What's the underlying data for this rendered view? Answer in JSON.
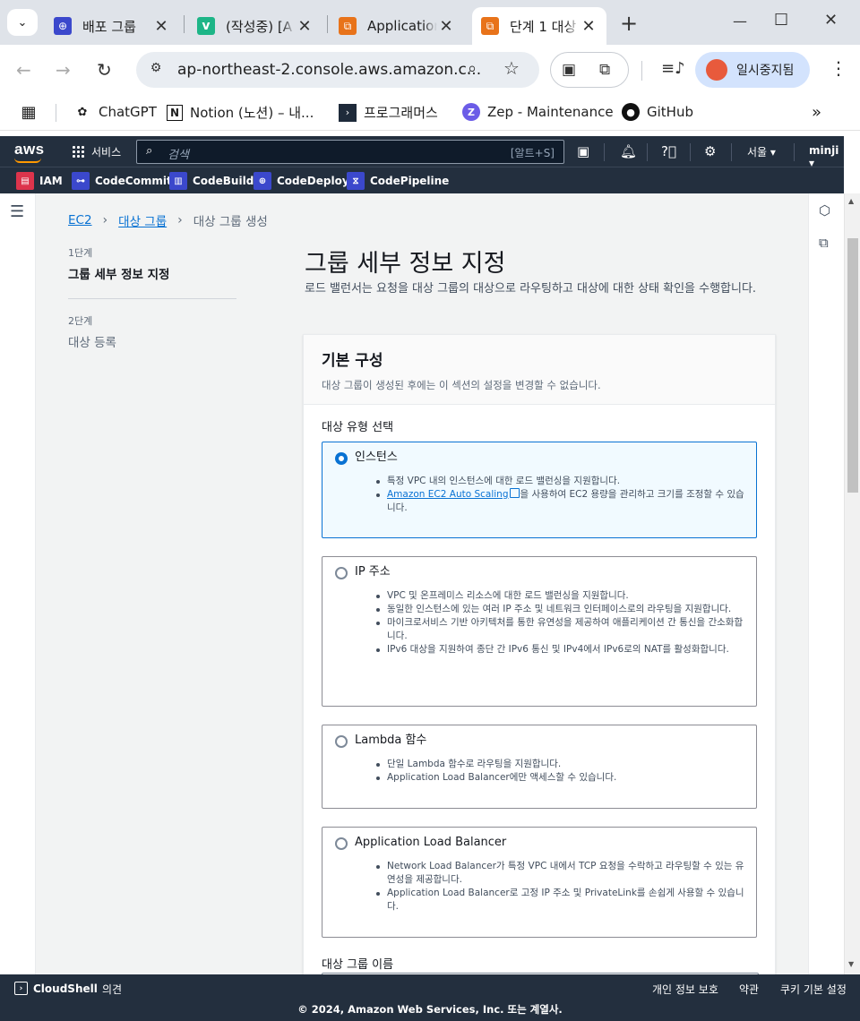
{
  "browser": {
    "tabs": [
      {
        "title": "배포 그룹",
        "favicon_color": "#3b48cc",
        "favicon_glyph": "⊕"
      },
      {
        "title": "(작성중) [A",
        "favicon_color": "#1db587",
        "favicon_glyph": "v"
      },
      {
        "title": "Application",
        "favicon_color": "#e8731a",
        "favicon_glyph": "⧉"
      },
      {
        "title": "단계 1 대상",
        "favicon_color": "#e8731a",
        "favicon_glyph": "⧉"
      }
    ],
    "url": "ap-northeast-2.console.aws.amazon.c...",
    "profile_label": "일시중지됨",
    "bookmarks": [
      {
        "label": "ChatGPT",
        "icon": "chatgpt-icon"
      },
      {
        "label": "Notion (노션) – 내...",
        "icon": "notion-icon"
      },
      {
        "label": "프로그래머스",
        "icon": "programmers-icon"
      },
      {
        "label": "Zep - Maintenance",
        "icon": "zep-icon"
      },
      {
        "label": "GitHub",
        "icon": "github-icon"
      }
    ]
  },
  "aws": {
    "logo": "aws",
    "services_label": "서비스",
    "search_placeholder": "검색",
    "search_shortcut": "[알트+S]",
    "region": "서울 ▾",
    "user": "minji ▾",
    "favorites": [
      {
        "label": "IAM",
        "color": "#dd344c"
      },
      {
        "label": "CodeCommit",
        "color": "#3b48cc"
      },
      {
        "label": "CodeBuild",
        "color": "#3b48cc"
      },
      {
        "label": "CodeDeploy",
        "color": "#3b48cc"
      },
      {
        "label": "CodePipeline",
        "color": "#3b48cc"
      }
    ]
  },
  "breadcrumb": {
    "items": [
      "EC2",
      "대상 그룹",
      "대상 그룹 생성"
    ]
  },
  "steps": [
    {
      "label": "1단계",
      "title": "그룹 세부 정보 지정"
    },
    {
      "label": "2단계",
      "title": "대상 등록"
    }
  ],
  "page": {
    "title": "그룹 세부 정보 지정",
    "description": "로드 밸런서는 요청을 대상 그룹의 대상으로 라우팅하고 대상에 대한 상태 확인을 수행합니다."
  },
  "basic_config": {
    "title": "기본 구성",
    "subtitle": "대상 그룹이 생성된 후에는 이 섹션의 설정을 변경할 수 없습니다.",
    "target_type_label": "대상 유형 선택",
    "options": [
      {
        "title": "인스턴스",
        "selected": true,
        "bullets": [
          "특정 VPC 내의 인스턴스에 대한 로드 밸런싱을 지원합니다.",
          "을 사용하여 EC2 용량을 관리하고 크기를 조정할 수 있습니다."
        ],
        "link": "Amazon EC2 Auto Scaling"
      },
      {
        "title": "IP 주소",
        "selected": false,
        "bullets": [
          "VPC 및 온프레미스 리소스에 대한 로드 밸런싱을 지원합니다.",
          "동일한 인스턴스에 있는 여러 IP 주소 및 네트워크 인터페이스로의 라우팅을 지원합니다.",
          "마이크로서비스 기반 아키텍처를 통한 유연성을 제공하여 애플리케이션 간 통신을 간소화합니다.",
          "IPv6 대상을 지원하여 종단 간 IPv6 통신 및 IPv4에서 IPv6로의 NAT를 활성화합니다."
        ]
      },
      {
        "title": "Lambda 함수",
        "selected": false,
        "bullets": [
          "단일 Lambda 함수로 라우팅을 지원합니다.",
          "Application Load Balancer에만 액세스할 수 있습니다."
        ]
      },
      {
        "title": "Application Load Balancer",
        "selected": false,
        "bullets": [
          "Network Load Balancer가 특정 VPC 내에서 TCP 요청을 수락하고 라우팅할 수 있는 유연성을 제공합니다.",
          "Application Load Balancer로 고정 IP 주소 및 PrivateLink를 손쉽게 사용할 수 있습니다."
        ]
      }
    ],
    "name_label": "대상 그룹 이름"
  },
  "footer": {
    "cloudshell": "CloudShell",
    "feedback": "의견",
    "privacy": "개인 정보 보호",
    "terms": "약관",
    "cookies": "쿠키 기본 설정",
    "copyright": "© 2024, Amazon Web Services, Inc. 또는 계열사."
  }
}
